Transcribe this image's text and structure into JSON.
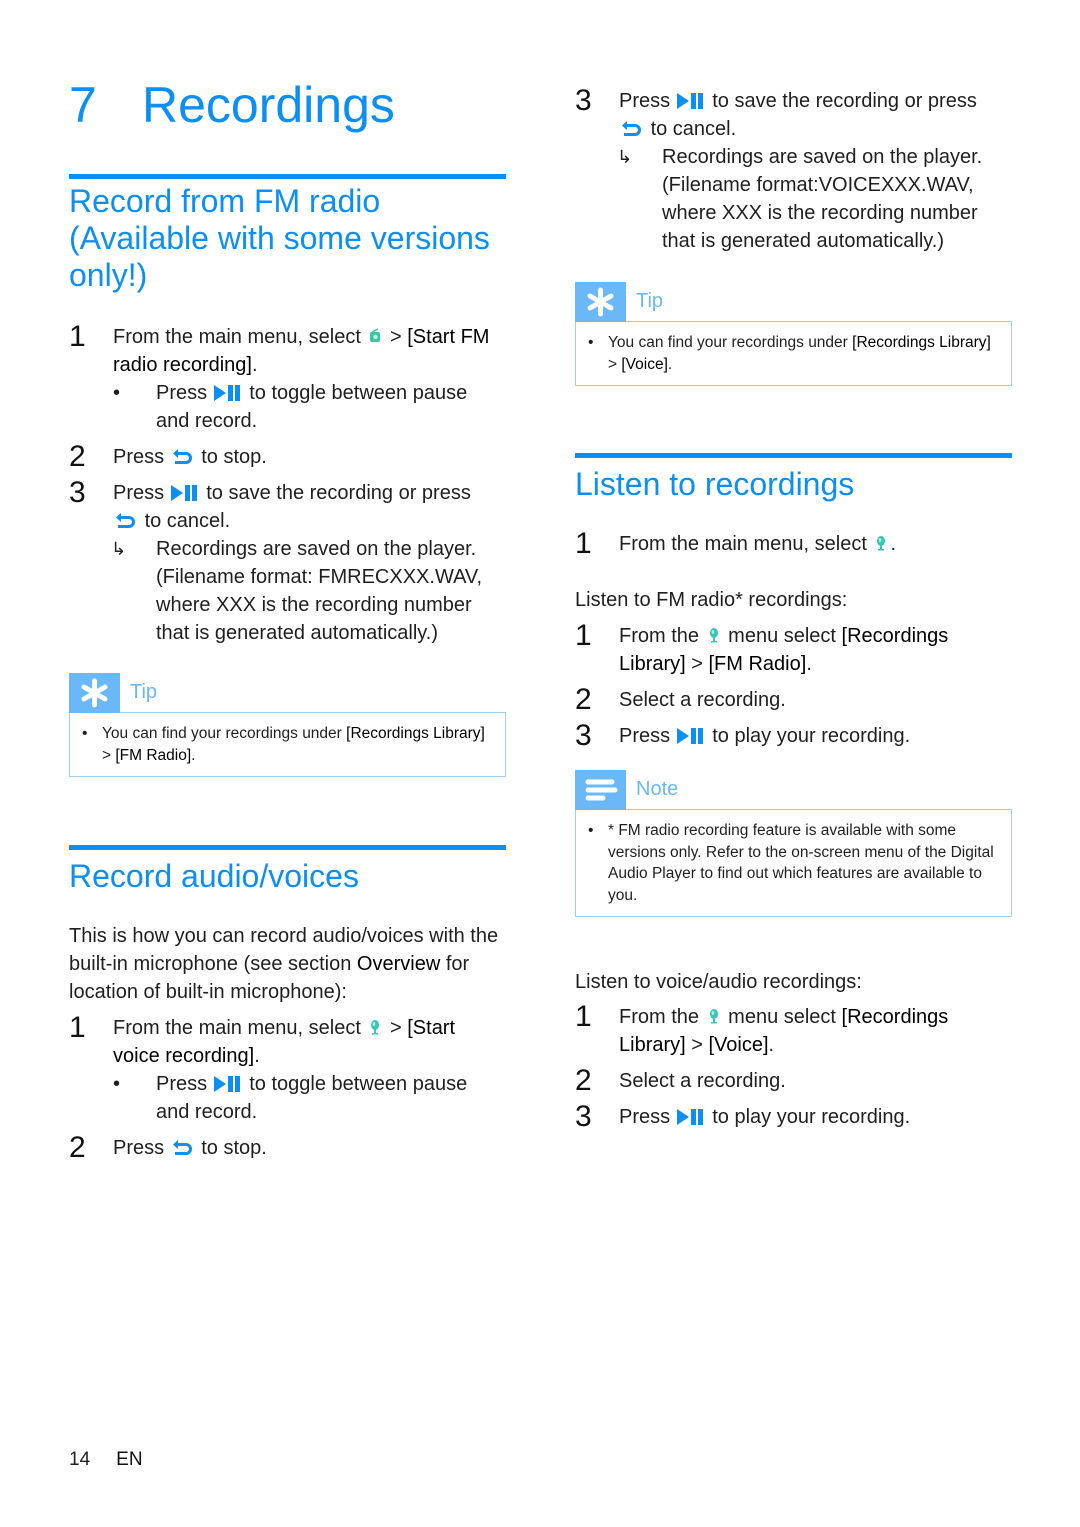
{
  "chapter": {
    "number": "7",
    "title": "Recordings"
  },
  "icons": {
    "play_pause": "play-pause-icon",
    "back": "back-arrow-icon",
    "radio": "fm-radio-menu-icon",
    "recordings": "recordings-menu-icon",
    "tip": "tip-asterisk-icon",
    "note": "note-lines-icon",
    "result_arrow": "result-arrow-icon"
  },
  "colors": {
    "accent": "#0b8ff5",
    "callout": "#6ab8f7",
    "callout_border": "#9fd0f7"
  },
  "fm_section": {
    "title": "Record from FM radio (Available with some versions only!)",
    "steps": [
      {
        "n": "1",
        "pre": "From the main menu, select",
        "post": " > ",
        "bold": "[Start FM radio recording]",
        "end": ".",
        "sub": {
          "pre": "Press",
          "post": "to toggle between pause and record."
        }
      },
      {
        "n": "2",
        "pre": "Press",
        "post": "to stop."
      },
      {
        "n": "3",
        "pre": "Press",
        "mid": "to save the recording or press",
        "post": "to cancel.",
        "result": "Recordings are saved on the player. (Filename format: FMRECXXX.WAV, where XXX is the recording number that is generated automatically.)"
      }
    ],
    "tip": {
      "label": "Tip",
      "text_pre": "You can find your recordings under ",
      "bold1": "[Recordings Library]",
      "sep": " > ",
      "bold2": "[FM Radio]",
      "end": "."
    }
  },
  "voice_section": {
    "title": "Record audio/voices",
    "intro_pre": "This is how you can record audio/voices with the built-in microphone (see section ",
    "intro_bold": "Overview",
    "intro_post": " for location of built-in microphone):",
    "steps": [
      {
        "n": "1",
        "pre": "From the main menu, select",
        "post": " > ",
        "bold": "[Start voice recording]",
        "end": ".",
        "sub": {
          "pre": "Press",
          "post": "to toggle between pause and record."
        }
      },
      {
        "n": "2",
        "pre": "Press",
        "post": "to stop."
      },
      {
        "n": "3",
        "pre": "Press",
        "mid": "to save the recording or press",
        "post": "to cancel.",
        "result": "Recordings are saved on the player. (Filename format:VOICEXXX.WAV, where XXX is the recording number that is generated automatically.)"
      }
    ],
    "tip": {
      "label": "Tip",
      "text_pre": "You can find your recordings under ",
      "bold1": "[Recordings Library]",
      "sep": " > ",
      "bold2": "[Voice]",
      "end": "."
    }
  },
  "listen_section": {
    "title": "Listen to recordings",
    "step1": {
      "n": "1",
      "pre": "From the main menu, select",
      "end": "."
    },
    "fm_heading": "Listen to FM radio* recordings:",
    "fm_steps": [
      {
        "n": "1",
        "pre": "From the",
        "mid": "menu select ",
        "bold1": "[Recordings Library]",
        "sep": " > ",
        "bold2": "[FM Radio]",
        "end": "."
      },
      {
        "n": "2",
        "text": "Select a recording."
      },
      {
        "n": "3",
        "pre": "Press",
        "post": "to play your recording."
      }
    ],
    "note": {
      "label": "Note",
      "text": "* FM radio recording feature is available with some versions only. Refer to the on-screen menu of the Digital Audio Player to find out which features are available to you."
    },
    "voice_heading": "Listen to voice/audio recordings:",
    "voice_steps": [
      {
        "n": "1",
        "pre": "From the",
        "mid": "menu select ",
        "bold1": "[Recordings Library]",
        "sep": " > ",
        "bold2": "[Voice]",
        "end": "."
      },
      {
        "n": "2",
        "text": "Select a recording."
      },
      {
        "n": "3",
        "pre": "Press",
        "post": "to play your recording."
      }
    ]
  },
  "footer": {
    "page": "14",
    "lang": "EN"
  }
}
